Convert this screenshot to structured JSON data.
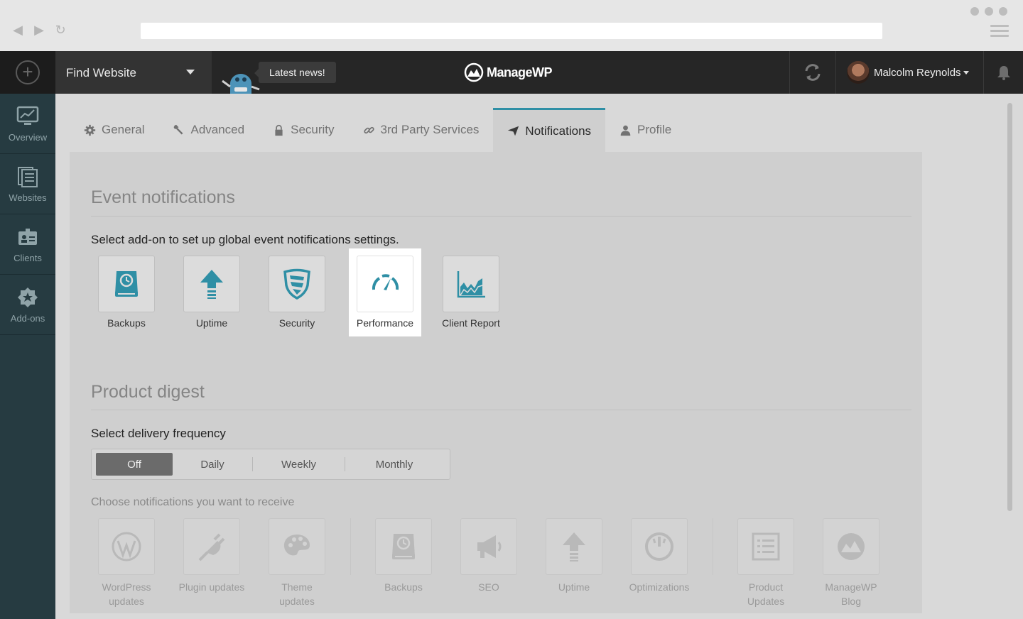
{
  "topbar": {
    "find_website": "Find Website",
    "news": "Latest news!",
    "logo": "ManageWP",
    "user_name": "Malcolm Reynolds"
  },
  "sidebar": {
    "items": [
      {
        "label": "Overview",
        "icon": "monitor-chart-icon"
      },
      {
        "label": "Websites",
        "icon": "pages-icon"
      },
      {
        "label": "Clients",
        "icon": "id-card-icon"
      },
      {
        "label": "Add-ons",
        "icon": "star-badge-icon"
      }
    ]
  },
  "tabs": [
    {
      "label": "General",
      "icon": "gear-icon"
    },
    {
      "label": "Advanced",
      "icon": "wrench-icon"
    },
    {
      "label": "Security",
      "icon": "lock-icon"
    },
    {
      "label": "3rd Party Services",
      "icon": "link-icon"
    },
    {
      "label": "Notifications",
      "icon": "paper-plane-icon",
      "active": true
    },
    {
      "label": "Profile",
      "icon": "user-icon"
    }
  ],
  "event_notifications": {
    "title": "Event notifications",
    "instruction": "Select add-on to set up global event notifications settings.",
    "addons": [
      {
        "label": "Backups",
        "icon": "backup-drive-icon"
      },
      {
        "label": "Uptime",
        "icon": "up-arrow-icon"
      },
      {
        "label": "Security",
        "icon": "shield-icon"
      },
      {
        "label": "Performance",
        "icon": "speedometer-icon",
        "selected": true
      },
      {
        "label": "Client Report",
        "icon": "area-chart-icon"
      }
    ]
  },
  "product_digest": {
    "title": "Product digest",
    "frequency_label": "Select delivery frequency",
    "frequency_options": [
      "Off",
      "Daily",
      "Weekly",
      "Monthly"
    ],
    "frequency_selected": "Off",
    "choose_label": "Choose notifications you want to receive",
    "notifications": [
      {
        "line1": "WordPress",
        "line2": "updates",
        "icon": "wordpress-icon"
      },
      {
        "line1": "Plugin updates",
        "line2": "",
        "icon": "plug-icon"
      },
      {
        "line1": "Theme",
        "line2": "updates",
        "icon": "palette-icon"
      },
      {
        "line1": "Backups",
        "line2": "",
        "icon": "backup-drive-icon"
      },
      {
        "line1": "SEO",
        "line2": "",
        "icon": "megaphone-icon"
      },
      {
        "line1": "Uptime",
        "line2": "",
        "icon": "up-arrow-icon"
      },
      {
        "line1": "Optimizations",
        "line2": "",
        "icon": "gauge-icon"
      },
      {
        "line1": "Product",
        "line2": "Updates",
        "icon": "list-icon"
      },
      {
        "line1": "ManageWP",
        "line2": "Blog",
        "icon": "managewp-logo-icon"
      }
    ]
  },
  "colors": {
    "accent": "#2f8fa5",
    "sidebar": "#263b41",
    "topbar": "#262626"
  }
}
